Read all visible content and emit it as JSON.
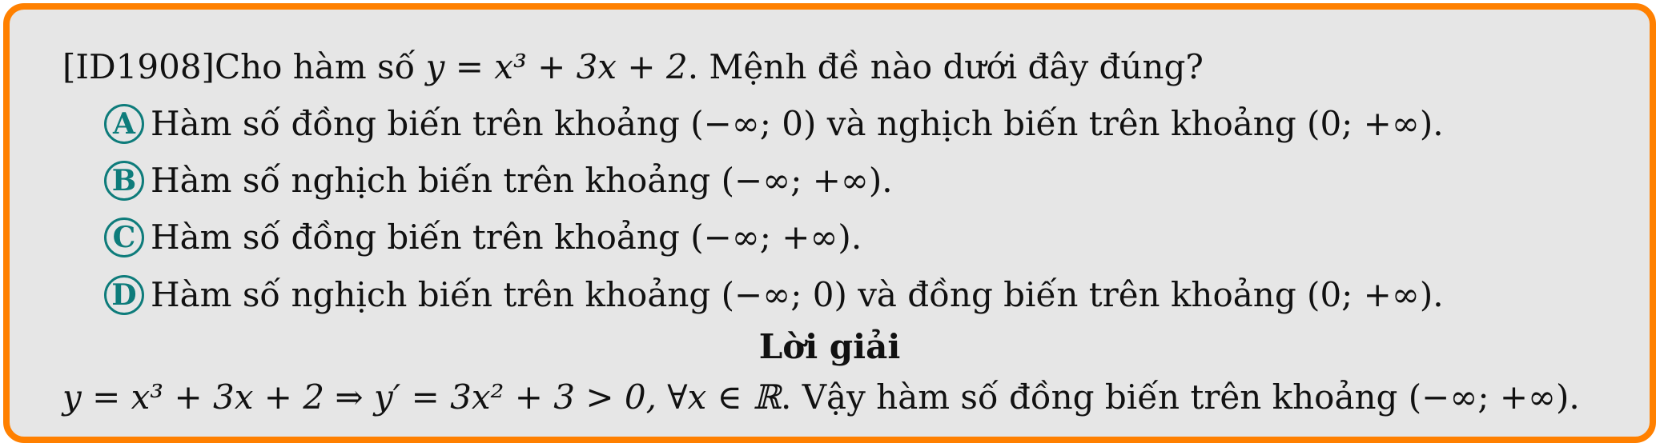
{
  "question": {
    "id_tag": "[ID1908]",
    "stem_prefix": "Cho hàm số ",
    "function_expr": "y = x³ + 3x + 2",
    "stem_suffix": ". Mệnh đề nào dưới đây đúng?"
  },
  "options": [
    {
      "letter": "A",
      "text": "Hàm số đồng biến trên khoảng (−∞; 0) và nghịch biến trên khoảng (0; +∞)."
    },
    {
      "letter": "B",
      "text": "Hàm số nghịch biến trên khoảng (−∞; +∞)."
    },
    {
      "letter": "C",
      "text": "Hàm số đồng biến trên khoảng (−∞; +∞)."
    },
    {
      "letter": "D",
      "text": "Hàm số nghịch biến trên khoảng (−∞; 0) và đồng biến trên khoảng (0; +∞)."
    }
  ],
  "solution": {
    "title": "Lời giải",
    "math_expr": "y = x³ + 3x + 2 ⇒ y′ = 3x² + 3 > 0, ∀x ∈ ℝ",
    "conclusion": ". Vậy hàm số đồng biến trên khoảng (−∞; +∞)."
  },
  "colors": {
    "border": "#ff8000",
    "background": "#e6e6e6",
    "badge": "#0e7c7b"
  }
}
